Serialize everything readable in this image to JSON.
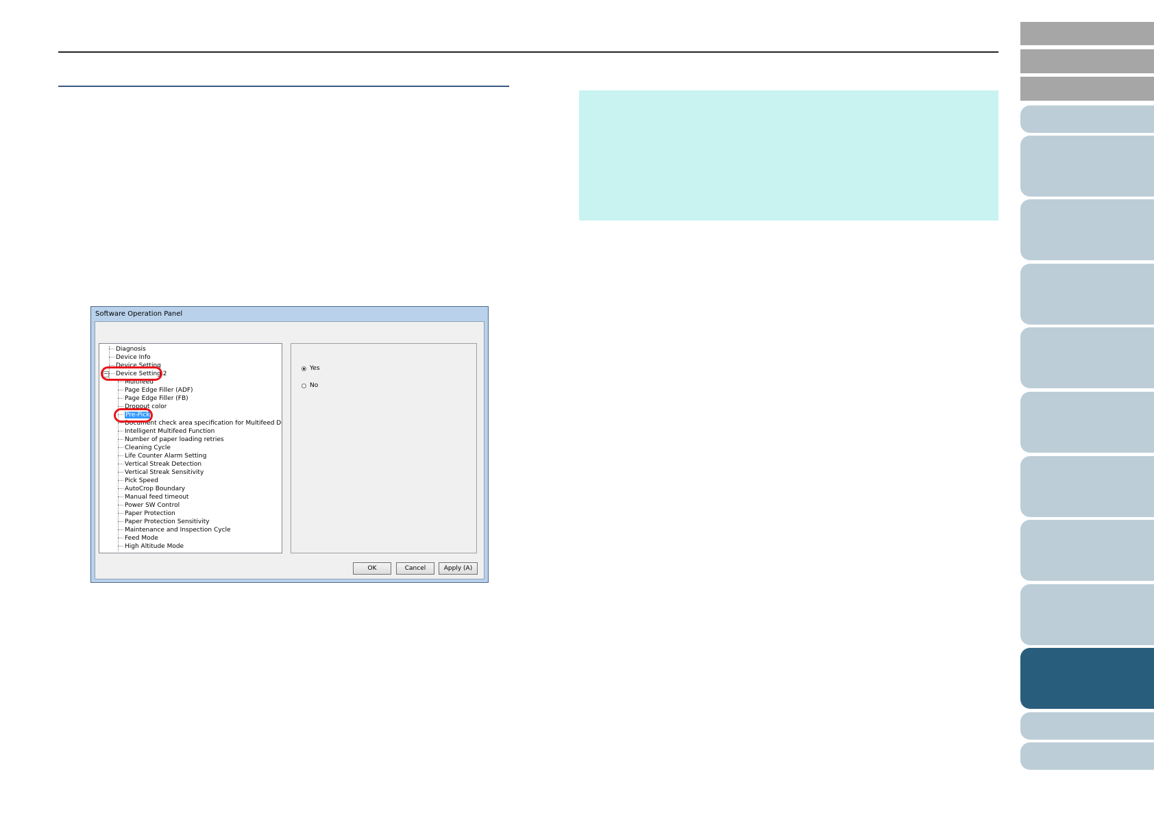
{
  "dialog": {
    "title": "Software Operation Panel",
    "tree": {
      "top_items": [
        "Diagnosis",
        "Device Info",
        "Device Setting",
        "Device Setting 2"
      ],
      "expander_symbol": "−",
      "sub_items": [
        "Multifeed",
        "Page Edge Filler (ADF)",
        "Page Edge Filler (FB)",
        "Dropout color",
        "Pre-Pick",
        "Document check area specification for Multifeed Detection",
        "Intelligent Multifeed Function",
        "Number of paper loading retries",
        "Cleaning Cycle",
        "Life Counter Alarm Setting",
        "Vertical Streak Detection",
        "Vertical Streak Sensitivity",
        "Pick Speed",
        "AutoCrop Boundary",
        "Manual feed timeout",
        "Power SW Control",
        "Paper Protection",
        "Paper Protection Sensitivity",
        "Maintenance and Inspection Cycle",
        "Feed Mode",
        "High Altitude Mode"
      ],
      "selected_item": "Pre-Pick"
    },
    "options": {
      "yes_label": "Yes",
      "no_label": "No",
      "selected": "Yes"
    },
    "buttons": {
      "ok": "OK",
      "cancel": "Cancel",
      "apply": "Apply (A)"
    }
  },
  "colors": {
    "highlight_ring": "#e8141b",
    "hint_box": "#c8f3f1",
    "active_tab": "#285e7c",
    "tab": "#bccdd7",
    "gray_tab": "#a6a6a6"
  }
}
